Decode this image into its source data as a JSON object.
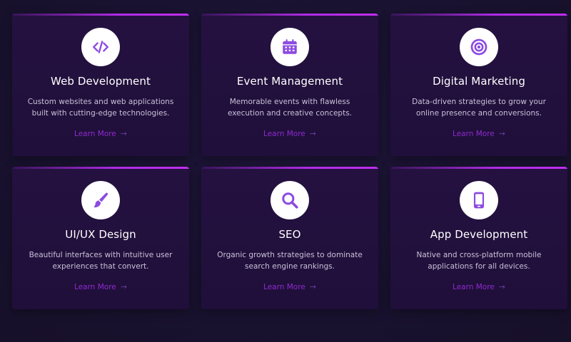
{
  "services": [
    {
      "icon": "code-icon",
      "title": "Web Development",
      "description": "Custom websites and web applications built with cutting-edge technologies.",
      "link_label": "Learn More"
    },
    {
      "icon": "calendar-icon",
      "title": "Event Management",
      "description": "Memorable events with flawless execution and creative concepts.",
      "link_label": "Learn More"
    },
    {
      "icon": "target-icon",
      "title": "Digital Marketing",
      "description": "Data-driven strategies to grow your online presence and conversions.",
      "link_label": "Learn More"
    },
    {
      "icon": "paintbrush-icon",
      "title": "UI/UX Design",
      "description": "Beautiful interfaces with intuitive user experiences that convert.",
      "link_label": "Learn More"
    },
    {
      "icon": "search-icon",
      "title": "SEO",
      "description": "Organic growth strategies to dominate search engine rankings.",
      "link_label": "Learn More"
    },
    {
      "icon": "mobile-phone-icon",
      "title": "App Development",
      "description": "Native and cross-platform mobile applications for all devices.",
      "link_label": "Learn More"
    }
  ],
  "colors": {
    "background": "#1a1230",
    "card": "#220f3c",
    "accent": "#b02be6",
    "icon": "#8c4be0",
    "link": "#8e2ad0"
  }
}
